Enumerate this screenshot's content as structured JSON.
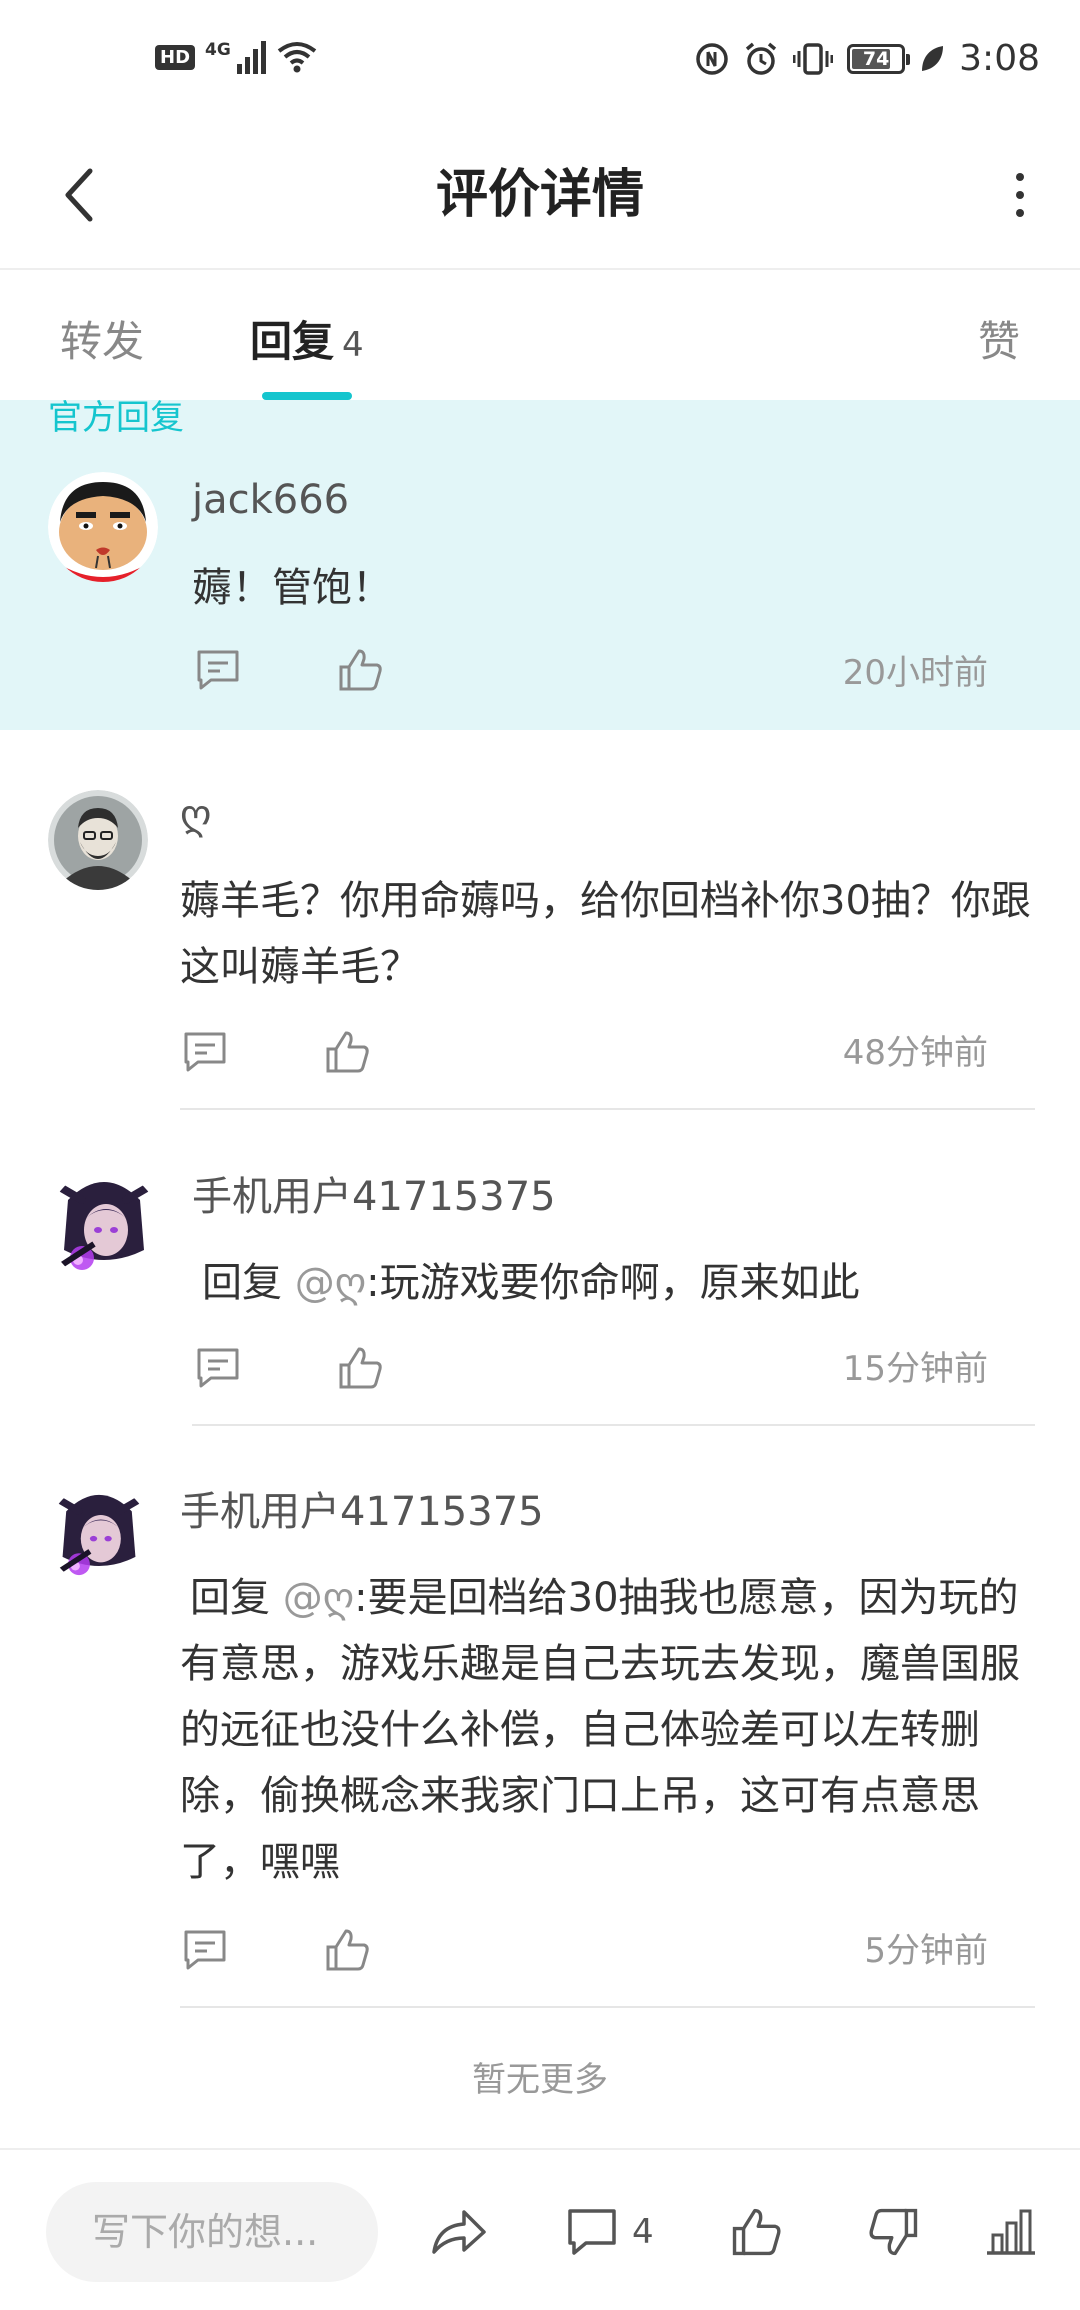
{
  "status_bar": {
    "hd": "HD",
    "network": "4G",
    "battery": "74",
    "time": "3:08"
  },
  "header": {
    "title": "评价详情"
  },
  "tabs": {
    "forward": "转发",
    "reply": "回复",
    "reply_count": "4",
    "like": "赞"
  },
  "official": {
    "label": "官方回复",
    "username": "jack666",
    "content": "薅！管饱！",
    "time": "20小时前"
  },
  "replies": [
    {
      "username": "ღ",
      "content": "薅羊毛？你用命薅吗，给你回档补你30抽？你跟这叫薅羊毛？",
      "time": "48分钟前"
    },
    {
      "username": "手机用户41715375",
      "reply_prefix": "回复 ",
      "mention": "@ღ",
      "content": ":玩游戏要你命啊，原来如此",
      "time": "15分钟前"
    },
    {
      "username": "手机用户41715375",
      "reply_prefix": "回复 ",
      "mention": "@ღ",
      "content": ":要是回档给30抽我也愿意，因为玩的有意思，游戏乐趣是自己去玩去发现，魔兽国服的远征也没什么补偿，自己体验差可以左转删除，偷换概念来我家门口上吊，这可有点意思了，嘿嘿",
      "time": "5分钟前"
    }
  ],
  "footer": {
    "no_more": "暂无更多"
  },
  "bottom_bar": {
    "input_placeholder": "写下你的想...",
    "comment_count": "4"
  },
  "colors": {
    "accent": "#15c5ce",
    "official_bg": "#e2f6f8"
  },
  "icons": [
    "back-arrow-icon",
    "more-vertical-icon",
    "comment-icon",
    "thumbs-up-icon",
    "share-icon",
    "thumbs-down-icon",
    "bar-chart-icon"
  ]
}
